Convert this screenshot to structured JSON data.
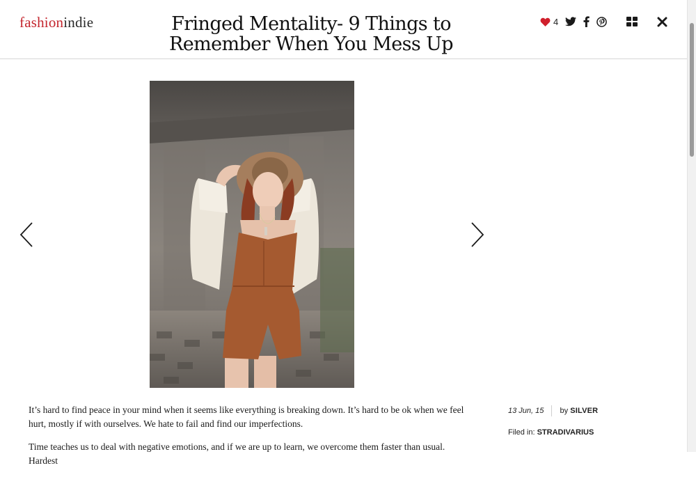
{
  "site": {
    "logo_part1": "fashion",
    "logo_part2": "indie"
  },
  "post": {
    "title": "Fringed Mentality- 9 Things to Remember When You Mess Up",
    "likes": "4",
    "date": "13 Jun, 15",
    "by_label": "by",
    "author": "SILVER",
    "filed_label": "Filed in:",
    "category": "STRADIVARIUS",
    "paragraphs": [
      "It’s hard to find peace in your mind when it seems like everything is breaking down. It’s hard to be ok when we feel hurt, mostly if with ourselves. We hate to fail and find our imperfections.",
      "Time teaches us to deal with negative emotions, and if we are up to learn, we overcome them faster than usual. Hardest"
    ]
  },
  "icons": {
    "heart": "heart-icon",
    "twitter": "twitter-icon",
    "facebook": "facebook-icon",
    "pinterest": "pinterest-icon",
    "grid": "grid-icon",
    "close": "close-icon",
    "prev": "chevron-left-icon",
    "next": "chevron-right-icon"
  },
  "colors": {
    "brand_red": "#c4262e",
    "heart": "#d0202c",
    "text": "#1a1a1a"
  }
}
